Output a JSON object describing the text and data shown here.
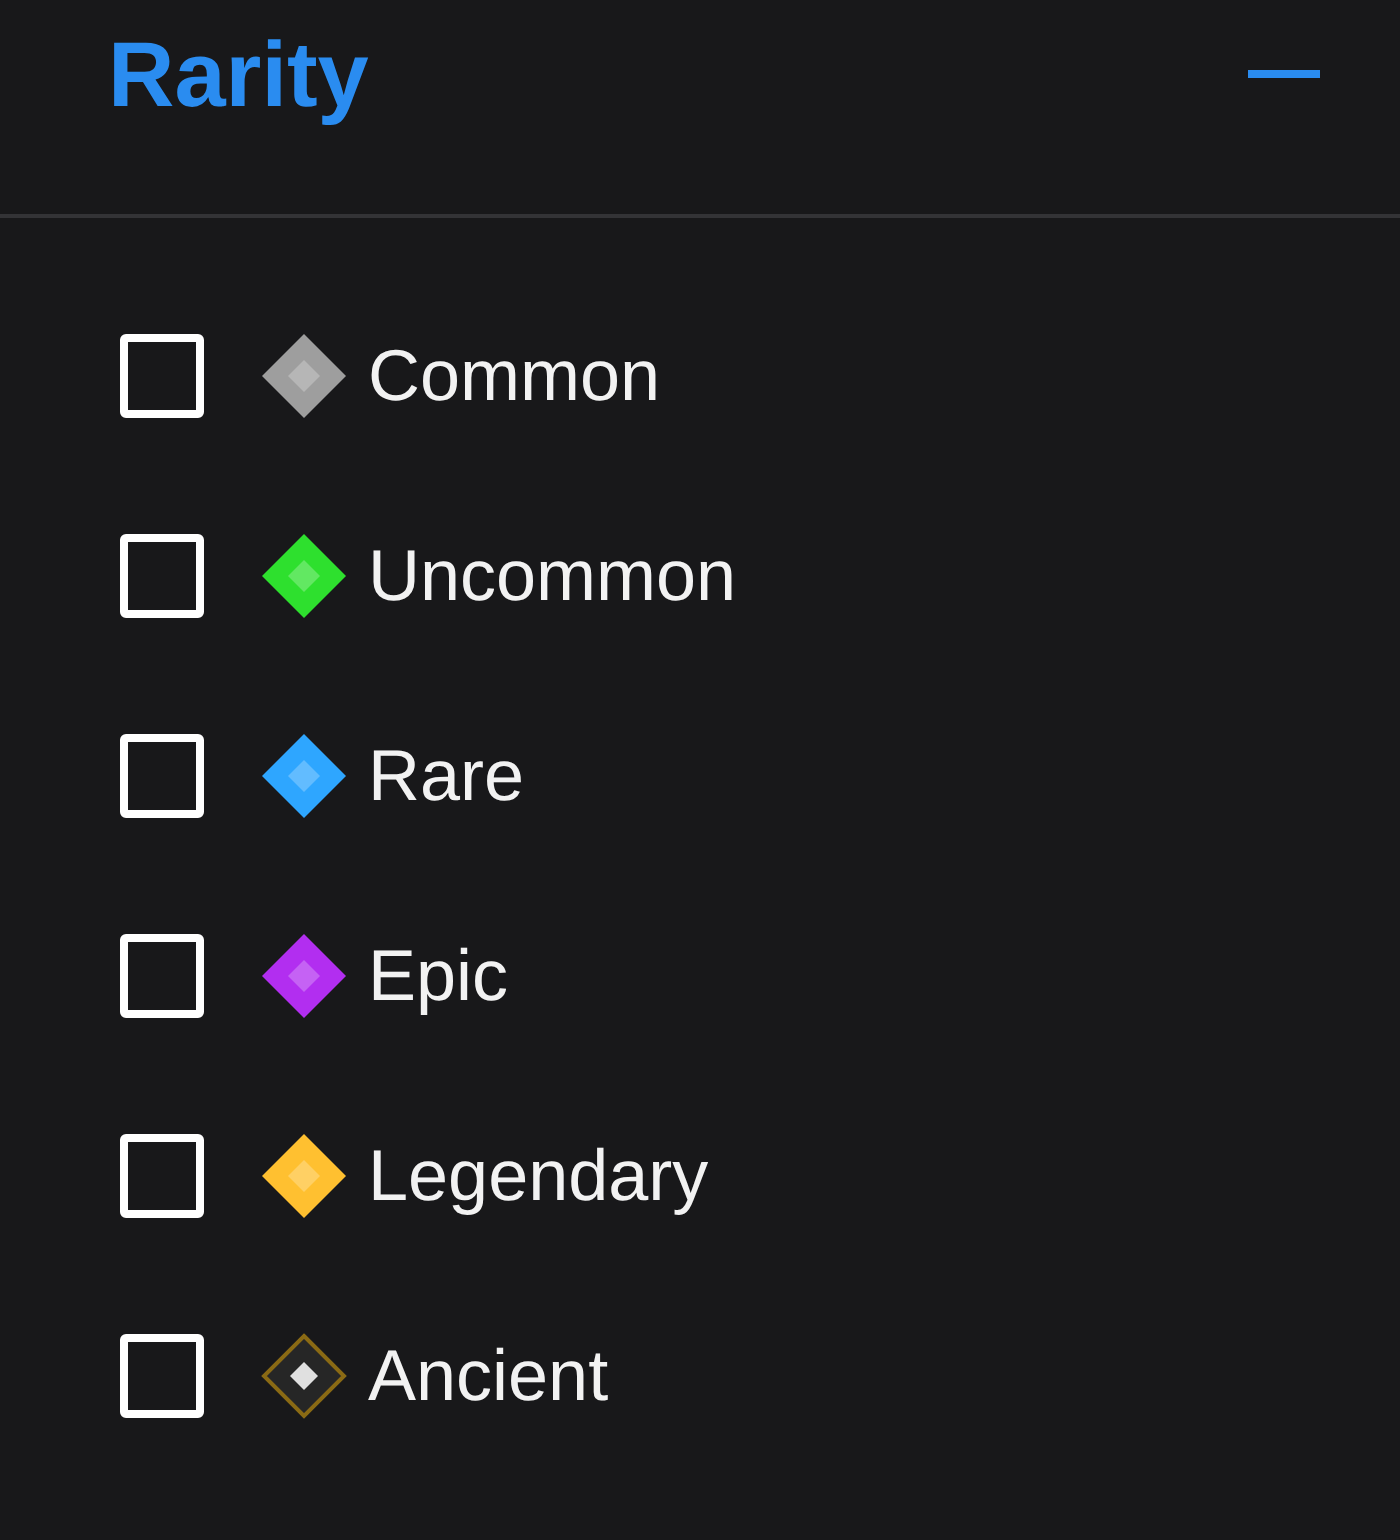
{
  "section": {
    "title": "Rarity",
    "expanded": true
  },
  "items": [
    {
      "label": "Common",
      "checked": false,
      "color": "#9e9e9e",
      "kind": "filled"
    },
    {
      "label": "Uncommon",
      "checked": false,
      "color": "#2ee02e",
      "kind": "filled"
    },
    {
      "label": "Rare",
      "checked": false,
      "color": "#2ea6ff",
      "kind": "filled"
    },
    {
      "label": "Epic",
      "checked": false,
      "color": "#b22ef0",
      "kind": "filled"
    },
    {
      "label": "Legendary",
      "checked": false,
      "color": "#ffc030",
      "kind": "filled"
    },
    {
      "label": "Ancient",
      "checked": false,
      "color": "#8a6a14",
      "kind": "outlined"
    }
  ]
}
